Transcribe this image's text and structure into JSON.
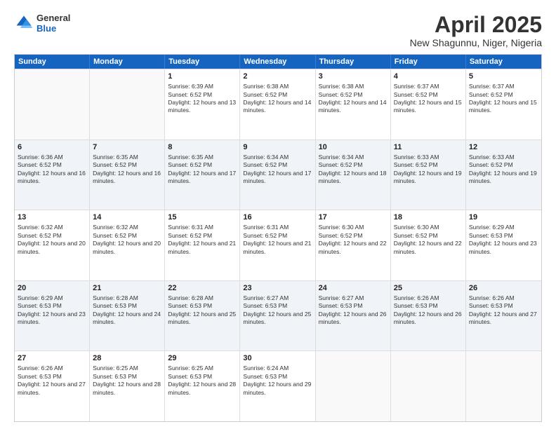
{
  "header": {
    "logo": {
      "general": "General",
      "blue": "Blue"
    },
    "title": "April 2025",
    "location": "New Shagunnu, Niger, Nigeria"
  },
  "days": [
    "Sunday",
    "Monday",
    "Tuesday",
    "Wednesday",
    "Thursday",
    "Friday",
    "Saturday"
  ],
  "weeks": [
    [
      {
        "day": "",
        "empty": true
      },
      {
        "day": "",
        "empty": true
      },
      {
        "day": "1",
        "sunrise": "Sunrise: 6:39 AM",
        "sunset": "Sunset: 6:52 PM",
        "daylight": "Daylight: 12 hours and 13 minutes."
      },
      {
        "day": "2",
        "sunrise": "Sunrise: 6:38 AM",
        "sunset": "Sunset: 6:52 PM",
        "daylight": "Daylight: 12 hours and 14 minutes."
      },
      {
        "day": "3",
        "sunrise": "Sunrise: 6:38 AM",
        "sunset": "Sunset: 6:52 PM",
        "daylight": "Daylight: 12 hours and 14 minutes."
      },
      {
        "day": "4",
        "sunrise": "Sunrise: 6:37 AM",
        "sunset": "Sunset: 6:52 PM",
        "daylight": "Daylight: 12 hours and 15 minutes."
      },
      {
        "day": "5",
        "sunrise": "Sunrise: 6:37 AM",
        "sunset": "Sunset: 6:52 PM",
        "daylight": "Daylight: 12 hours and 15 minutes."
      }
    ],
    [
      {
        "day": "6",
        "sunrise": "Sunrise: 6:36 AM",
        "sunset": "Sunset: 6:52 PM",
        "daylight": "Daylight: 12 hours and 16 minutes."
      },
      {
        "day": "7",
        "sunrise": "Sunrise: 6:35 AM",
        "sunset": "Sunset: 6:52 PM",
        "daylight": "Daylight: 12 hours and 16 minutes."
      },
      {
        "day": "8",
        "sunrise": "Sunrise: 6:35 AM",
        "sunset": "Sunset: 6:52 PM",
        "daylight": "Daylight: 12 hours and 17 minutes."
      },
      {
        "day": "9",
        "sunrise": "Sunrise: 6:34 AM",
        "sunset": "Sunset: 6:52 PM",
        "daylight": "Daylight: 12 hours and 17 minutes."
      },
      {
        "day": "10",
        "sunrise": "Sunrise: 6:34 AM",
        "sunset": "Sunset: 6:52 PM",
        "daylight": "Daylight: 12 hours and 18 minutes."
      },
      {
        "day": "11",
        "sunrise": "Sunrise: 6:33 AM",
        "sunset": "Sunset: 6:52 PM",
        "daylight": "Daylight: 12 hours and 19 minutes."
      },
      {
        "day": "12",
        "sunrise": "Sunrise: 6:33 AM",
        "sunset": "Sunset: 6:52 PM",
        "daylight": "Daylight: 12 hours and 19 minutes."
      }
    ],
    [
      {
        "day": "13",
        "sunrise": "Sunrise: 6:32 AM",
        "sunset": "Sunset: 6:52 PM",
        "daylight": "Daylight: 12 hours and 20 minutes."
      },
      {
        "day": "14",
        "sunrise": "Sunrise: 6:32 AM",
        "sunset": "Sunset: 6:52 PM",
        "daylight": "Daylight: 12 hours and 20 minutes."
      },
      {
        "day": "15",
        "sunrise": "Sunrise: 6:31 AM",
        "sunset": "Sunset: 6:52 PM",
        "daylight": "Daylight: 12 hours and 21 minutes."
      },
      {
        "day": "16",
        "sunrise": "Sunrise: 6:31 AM",
        "sunset": "Sunset: 6:52 PM",
        "daylight": "Daylight: 12 hours and 21 minutes."
      },
      {
        "day": "17",
        "sunrise": "Sunrise: 6:30 AM",
        "sunset": "Sunset: 6:52 PM",
        "daylight": "Daylight: 12 hours and 22 minutes."
      },
      {
        "day": "18",
        "sunrise": "Sunrise: 6:30 AM",
        "sunset": "Sunset: 6:52 PM",
        "daylight": "Daylight: 12 hours and 22 minutes."
      },
      {
        "day": "19",
        "sunrise": "Sunrise: 6:29 AM",
        "sunset": "Sunset: 6:53 PM",
        "daylight": "Daylight: 12 hours and 23 minutes."
      }
    ],
    [
      {
        "day": "20",
        "sunrise": "Sunrise: 6:29 AM",
        "sunset": "Sunset: 6:53 PM",
        "daylight": "Daylight: 12 hours and 23 minutes."
      },
      {
        "day": "21",
        "sunrise": "Sunrise: 6:28 AM",
        "sunset": "Sunset: 6:53 PM",
        "daylight": "Daylight: 12 hours and 24 minutes."
      },
      {
        "day": "22",
        "sunrise": "Sunrise: 6:28 AM",
        "sunset": "Sunset: 6:53 PM",
        "daylight": "Daylight: 12 hours and 25 minutes."
      },
      {
        "day": "23",
        "sunrise": "Sunrise: 6:27 AM",
        "sunset": "Sunset: 6:53 PM",
        "daylight": "Daylight: 12 hours and 25 minutes."
      },
      {
        "day": "24",
        "sunrise": "Sunrise: 6:27 AM",
        "sunset": "Sunset: 6:53 PM",
        "daylight": "Daylight: 12 hours and 26 minutes."
      },
      {
        "day": "25",
        "sunrise": "Sunrise: 6:26 AM",
        "sunset": "Sunset: 6:53 PM",
        "daylight": "Daylight: 12 hours and 26 minutes."
      },
      {
        "day": "26",
        "sunrise": "Sunrise: 6:26 AM",
        "sunset": "Sunset: 6:53 PM",
        "daylight": "Daylight: 12 hours and 27 minutes."
      }
    ],
    [
      {
        "day": "27",
        "sunrise": "Sunrise: 6:26 AM",
        "sunset": "Sunset: 6:53 PM",
        "daylight": "Daylight: 12 hours and 27 minutes."
      },
      {
        "day": "28",
        "sunrise": "Sunrise: 6:25 AM",
        "sunset": "Sunset: 6:53 PM",
        "daylight": "Daylight: 12 hours and 28 minutes."
      },
      {
        "day": "29",
        "sunrise": "Sunrise: 6:25 AM",
        "sunset": "Sunset: 6:53 PM",
        "daylight": "Daylight: 12 hours and 28 minutes."
      },
      {
        "day": "30",
        "sunrise": "Sunrise: 6:24 AM",
        "sunset": "Sunset: 6:53 PM",
        "daylight": "Daylight: 12 hours and 29 minutes."
      },
      {
        "day": "",
        "empty": true
      },
      {
        "day": "",
        "empty": true
      },
      {
        "day": "",
        "empty": true
      }
    ]
  ]
}
